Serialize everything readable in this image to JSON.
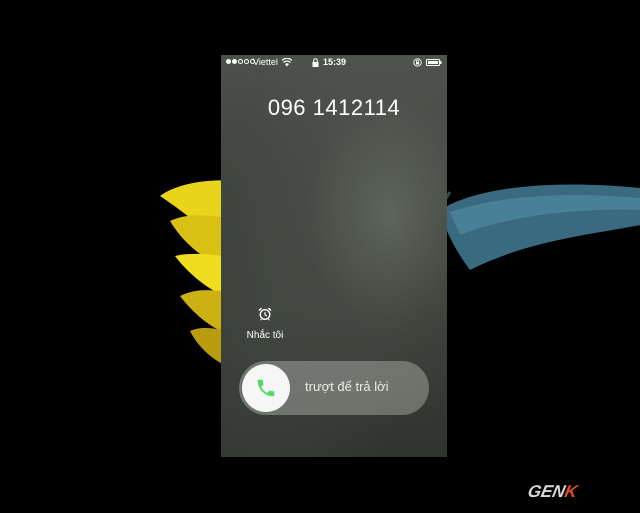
{
  "status_bar": {
    "carrier": "Viettel",
    "time": "15:39",
    "signal_bars_filled": 2,
    "signal_bars_total": 5
  },
  "call": {
    "caller_number": "096 1412114"
  },
  "actions": {
    "remind_me_label": "Nhắc tôi",
    "slide_to_answer_label": "trượt để trả lời"
  },
  "watermark": {
    "brand_main": "GEN",
    "brand_accent": "K"
  },
  "colors": {
    "answer_icon": "#4cd964",
    "watermark_accent": "#e14b1f"
  },
  "icons": [
    "wifi-icon",
    "lock-icon",
    "rotation-lock-icon",
    "battery-icon",
    "alarm-clock-icon",
    "phone-icon"
  ]
}
